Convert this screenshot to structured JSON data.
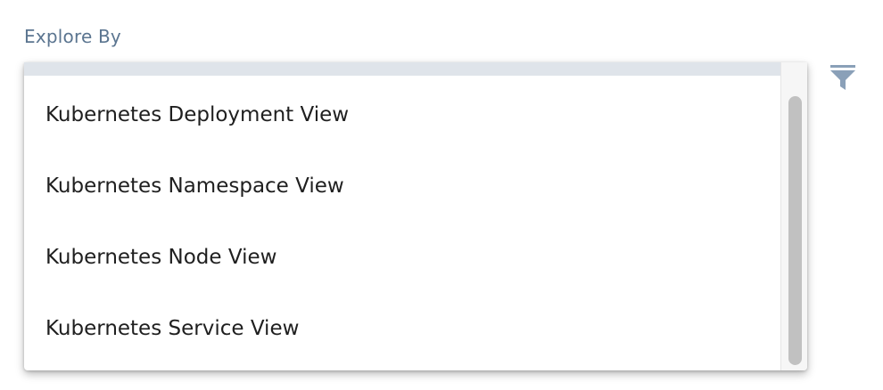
{
  "explore": {
    "label": "Explore By"
  },
  "toolbar": {
    "filter_icon": "filter-funnel-icon",
    "icon_color": "#8aa0b8"
  },
  "dropdown": {
    "options": [
      {
        "label": "Kubernetes Deployment View"
      },
      {
        "label": "Kubernetes Namespace View"
      },
      {
        "label": "Kubernetes Node View"
      },
      {
        "label": "Kubernetes Service View"
      }
    ]
  },
  "colors": {
    "label_text": "#5b7590",
    "option_text": "#1f1f1f",
    "topbar": "#dfe4ea",
    "scroll_thumb": "#c1c1c1"
  }
}
